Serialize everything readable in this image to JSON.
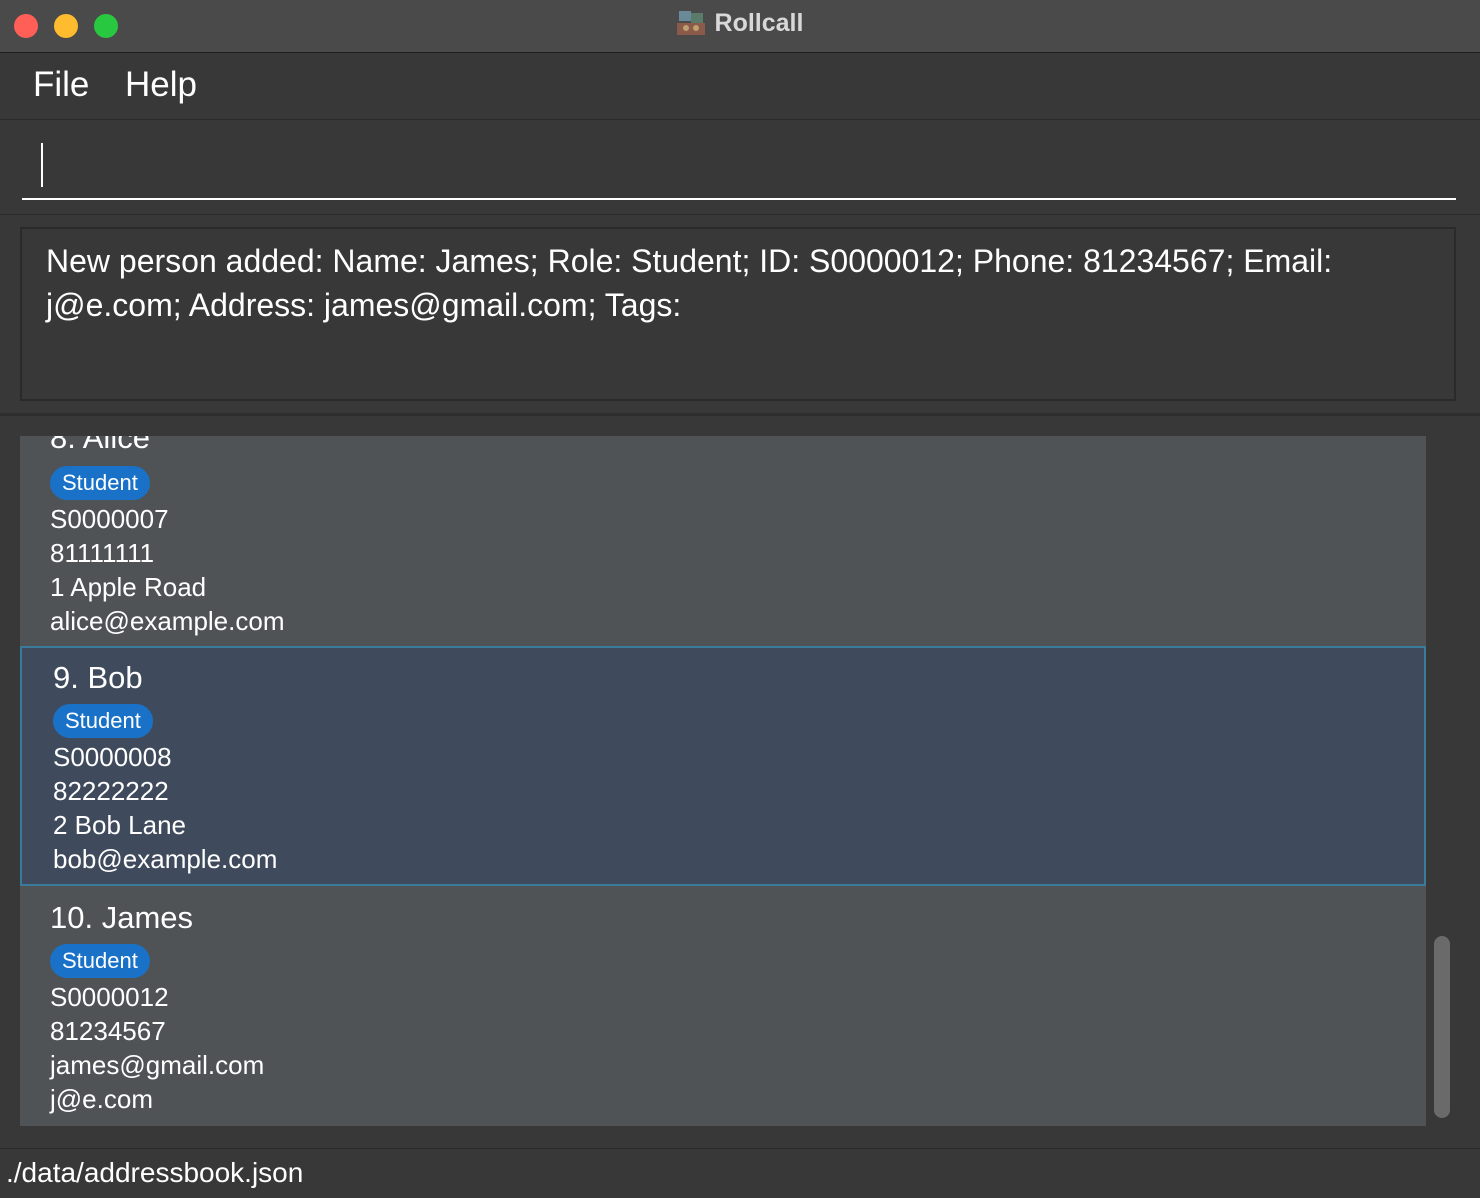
{
  "window": {
    "title": "Rollcall",
    "icon": "rollcall-app-icon"
  },
  "menu": {
    "items": [
      {
        "label": "File"
      },
      {
        "label": "Help"
      }
    ]
  },
  "command": {
    "value": "",
    "placeholder": ""
  },
  "result": {
    "message": "New person added: Name: James; Role: Student; ID: S0000012; Phone: 81234567; Email: j@e.com; Address: james@gmail.com; Tags:"
  },
  "persons": [
    {
      "index_name": "8. Alice",
      "role": "Student",
      "id": "S0000007",
      "phone": "81111111",
      "address": "1 Apple Road",
      "email": "alice@example.com",
      "selected": false
    },
    {
      "index_name": "9. Bob",
      "role": "Student",
      "id": "S0000008",
      "phone": "82222222",
      "address": "2 Bob Lane",
      "email": "bob@example.com",
      "selected": true
    },
    {
      "index_name": "10. James",
      "role": "Student",
      "id": "S0000012",
      "phone": "81234567",
      "address": "james@gmail.com",
      "email": "j@e.com",
      "selected": false
    }
  ],
  "status": {
    "file_path": "./data/addressbook.json"
  },
  "colors": {
    "role_tag": "#1a72c8",
    "selected_card": "#3f4b5d",
    "card": "#4f5356"
  }
}
